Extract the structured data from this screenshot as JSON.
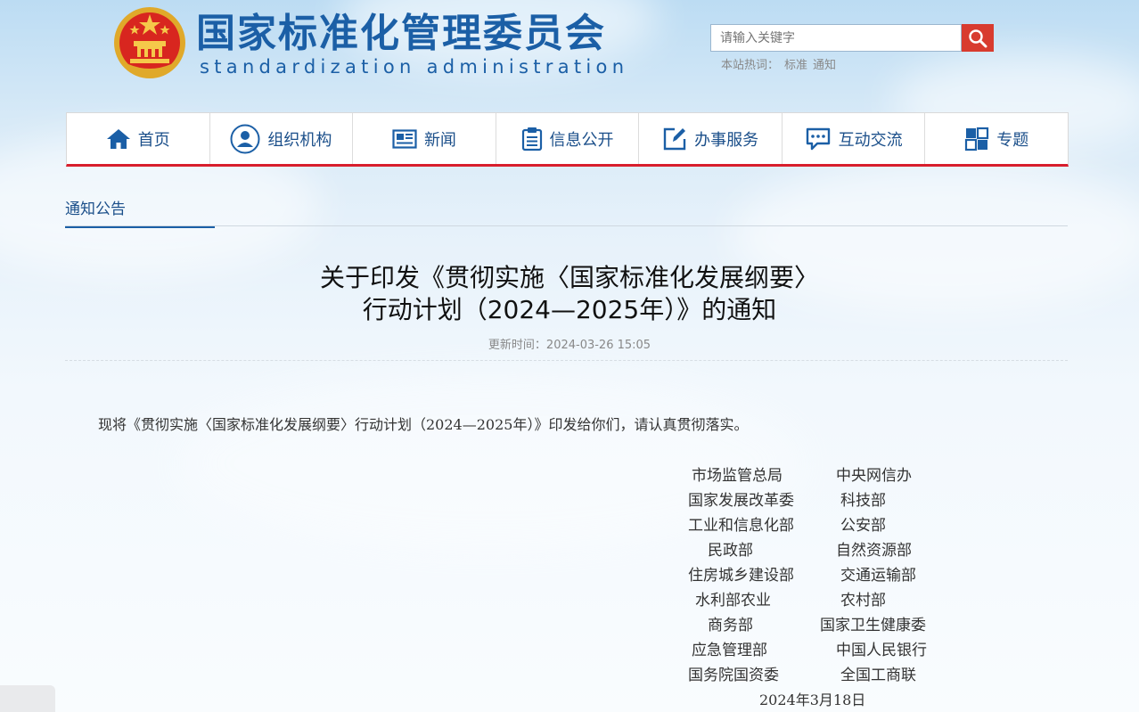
{
  "header": {
    "title": "国家标准化管理委员会",
    "subtitle": "standardization administration",
    "search_placeholder": "请输入关键字",
    "hot_label": "本站热词：",
    "hot_words": [
      "标准",
      "通知"
    ]
  },
  "nav": [
    {
      "label": "首页",
      "icon": "home-icon"
    },
    {
      "label": "组织机构",
      "icon": "user-icon"
    },
    {
      "label": "新闻",
      "icon": "newspaper-icon"
    },
    {
      "label": "信息公开",
      "icon": "clipboard-icon"
    },
    {
      "label": "办事服务",
      "icon": "edit-icon"
    },
    {
      "label": "互动交流",
      "icon": "chat-icon"
    },
    {
      "label": "专题",
      "icon": "topic-icon"
    }
  ],
  "colors": {
    "brand": "#1b5fa6",
    "accent": "#d81e2c"
  },
  "tab": "通知公告",
  "article": {
    "title_line1": "关于印发《贯彻实施〈国家标准化发展纲要〉",
    "title_line2": "行动计划（2024—2025年）》的通知",
    "update_time": "更新时间：2024-03-26 15:05",
    "body": "现将《贯彻实施〈国家标准化发展纲要〉行动计划（2024—2025年）》印发给你们，请认真贯彻落实。",
    "orgs": [
      [
        "市场监管总局",
        "中央网信办"
      ],
      [
        "国家发展改革委",
        "科技部"
      ],
      [
        "工业和信息化部",
        "公安部"
      ],
      [
        "民政部",
        "自然资源部"
      ],
      [
        "住房城乡建设部",
        "交通运输部"
      ],
      [
        "水利部农业",
        "农村部"
      ],
      [
        "商务部",
        "国家卫生健康委"
      ],
      [
        "应急管理部",
        "中国人民银行"
      ],
      [
        "国务院国资委",
        "全国工商联"
      ]
    ],
    "date": "2024年3月18日"
  }
}
